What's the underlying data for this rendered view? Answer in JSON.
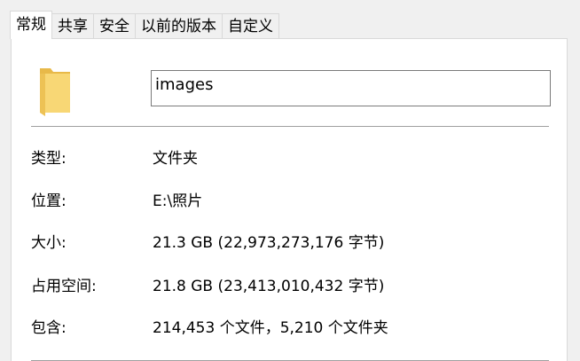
{
  "tabs": [
    {
      "label": "常规",
      "active": true
    },
    {
      "label": "共享",
      "active": false
    },
    {
      "label": "安全",
      "active": false
    },
    {
      "label": "以前的版本",
      "active": false
    },
    {
      "label": "自定义",
      "active": false
    }
  ],
  "general": {
    "icon": "folder-icon",
    "name_value": "images",
    "rows": [
      {
        "label": "类型:",
        "value": "文件夹"
      },
      {
        "label": "位置:",
        "value": "E:\\照片"
      },
      {
        "label": "大小:",
        "value": "21.3 GB (22,973,273,176 字节)"
      },
      {
        "label": "占用空间:",
        "value": "21.8 GB (23,413,010,432 字节)"
      },
      {
        "label": "包含:",
        "value": "214,453 个文件，5,210 个文件夹"
      }
    ]
  },
  "colors": {
    "folder_light": "#f8d775",
    "folder_dark": "#e8b949",
    "background": "#f0f0f0",
    "panel": "#ffffff"
  }
}
